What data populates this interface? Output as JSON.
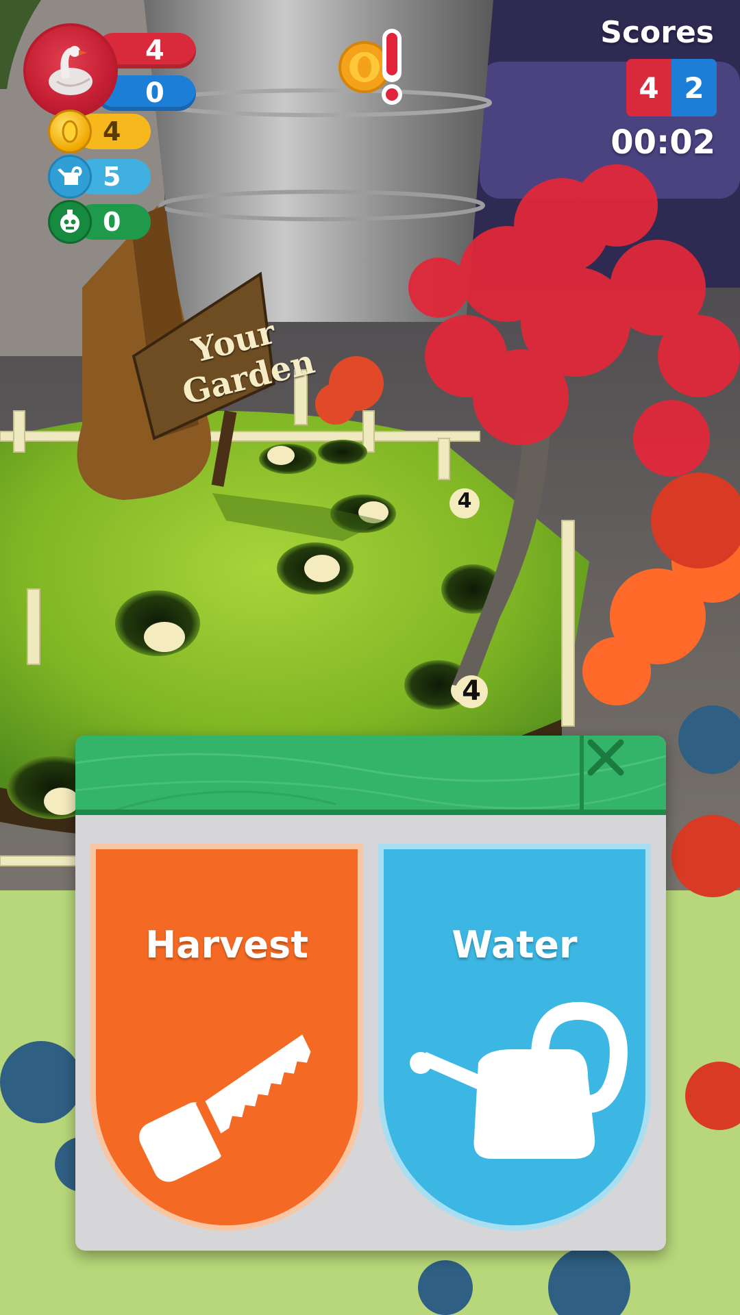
{
  "hud": {
    "player_red_score": "4",
    "player_blue_score": "0",
    "coins": "4",
    "water": "5",
    "poison": "0",
    "icons": {
      "avatar": "swan-avatar-icon",
      "coin": "coin-icon",
      "water": "watering-can-icon",
      "poison": "skull-bottle-icon",
      "alert": "coin-alert-icon"
    }
  },
  "scoreboard": {
    "title": "Scores",
    "red": "4",
    "blue": "2",
    "timer": "00:02"
  },
  "scene": {
    "sign_line1": "Your",
    "sign_line2": "Garden",
    "plot_labels": [
      "4",
      "4"
    ]
  },
  "action_panel": {
    "harvest_label": "Harvest",
    "water_label": "Water",
    "colors": {
      "harvest": "#f46a24",
      "water": "#3cb6e2",
      "header": "#34b468"
    }
  }
}
